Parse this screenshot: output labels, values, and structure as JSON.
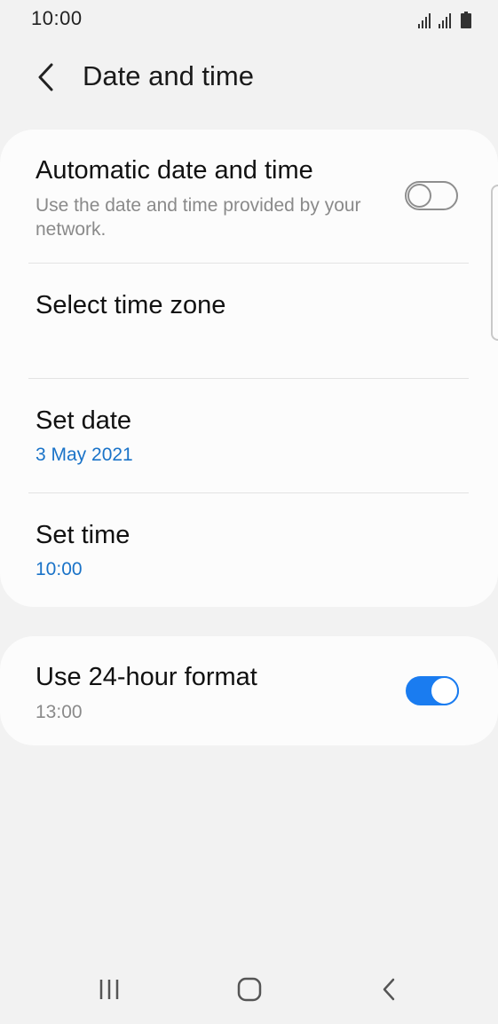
{
  "status_bar": {
    "time": "10:00",
    "icons": [
      "signal-icon",
      "signal-icon",
      "battery-icon"
    ]
  },
  "header": {
    "back_icon": "chevron-left-icon",
    "title": "Date and time"
  },
  "settings": {
    "automatic": {
      "title": "Automatic date and time",
      "subtitle": "Use the date and time provided by your network.",
      "enabled": false
    },
    "time_zone": {
      "title": "Select time zone"
    },
    "set_date": {
      "title": "Set date",
      "value": "3 May 2021"
    },
    "set_time": {
      "title": "Set time",
      "value": "10:00"
    },
    "format_24h": {
      "title": "Use 24-hour format",
      "value": "13:00",
      "enabled": true
    }
  },
  "nav_bar": {
    "recents_icon": "recents-icon",
    "home_icon": "home-icon",
    "back_icon": "back-icon"
  },
  "colors": {
    "accent": "#1a7cf0",
    "value_blue": "#1a73c8",
    "background": "#f2f2f2",
    "card": "#fcfcfc"
  }
}
